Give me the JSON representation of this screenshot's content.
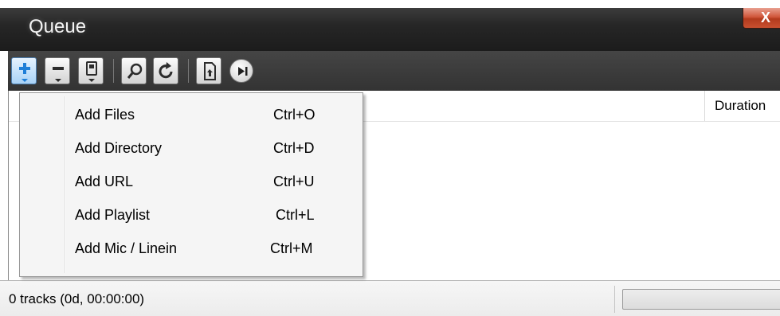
{
  "window": {
    "title": "Queue",
    "close_glyph": "X"
  },
  "toolbar": {
    "buttons": [
      {
        "name": "add-icon"
      },
      {
        "name": "remove-icon"
      },
      {
        "name": "save-icon"
      },
      {
        "name": "search-icon"
      },
      {
        "name": "refresh-icon"
      },
      {
        "name": "export-icon"
      },
      {
        "name": "play-next-icon"
      }
    ]
  },
  "list": {
    "columns": {
      "duration": "Duration"
    }
  },
  "menu": {
    "items": [
      {
        "label": "Add Files",
        "shortcut": "Ctrl+O"
      },
      {
        "label": "Add Directory",
        "shortcut": "Ctrl+D"
      },
      {
        "label": "Add URL",
        "shortcut": "Ctrl+U"
      },
      {
        "label": "Add Playlist",
        "shortcut": "Ctrl+L"
      },
      {
        "label": "Add Mic / Linein",
        "shortcut": "Ctrl+M"
      }
    ]
  },
  "status": {
    "text": "0 tracks (0d, 00:00:00)"
  },
  "colors": {
    "title_bar": "#262626",
    "close_button": "#c9502f",
    "menu_bg": "#f5f5f5"
  }
}
